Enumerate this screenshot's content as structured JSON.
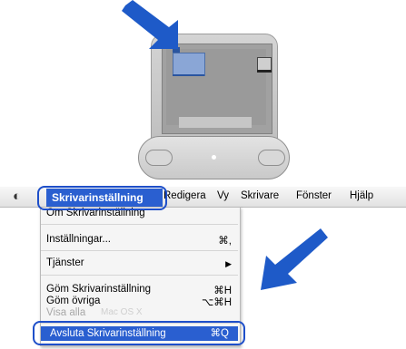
{
  "illustration": {
    "colors": {
      "arrow": "#1e5ac8",
      "window": "#8aa6d6",
      "highlight": "#2a5fd0"
    },
    "icons": [
      "imac-icon",
      "pointer-arrow-icon"
    ]
  },
  "menubar": {
    "apple_glyph": "◐",
    "app_menu": "Skrivarinställning",
    "menus": [
      "Redigera",
      "Vy",
      "Skrivare",
      "Fönster",
      "Hjälp"
    ]
  },
  "dropdown": {
    "about": "Om Skrivarinställning",
    "preferences": {
      "label": "Inställningar...",
      "key": "⌘,"
    },
    "services": {
      "label": "Tjänster",
      "key": "▶"
    },
    "hide": {
      "label": "Göm Skrivarinställning",
      "key": "⌘H"
    },
    "hide_others": {
      "label": "Göm övriga",
      "key": "⌥⌘H"
    },
    "show_all": {
      "label": "Visa alla",
      "ghost": "Mac OS X"
    },
    "quit": {
      "label": "Avsluta Skrivarinställning",
      "key": "⌘Q"
    }
  }
}
